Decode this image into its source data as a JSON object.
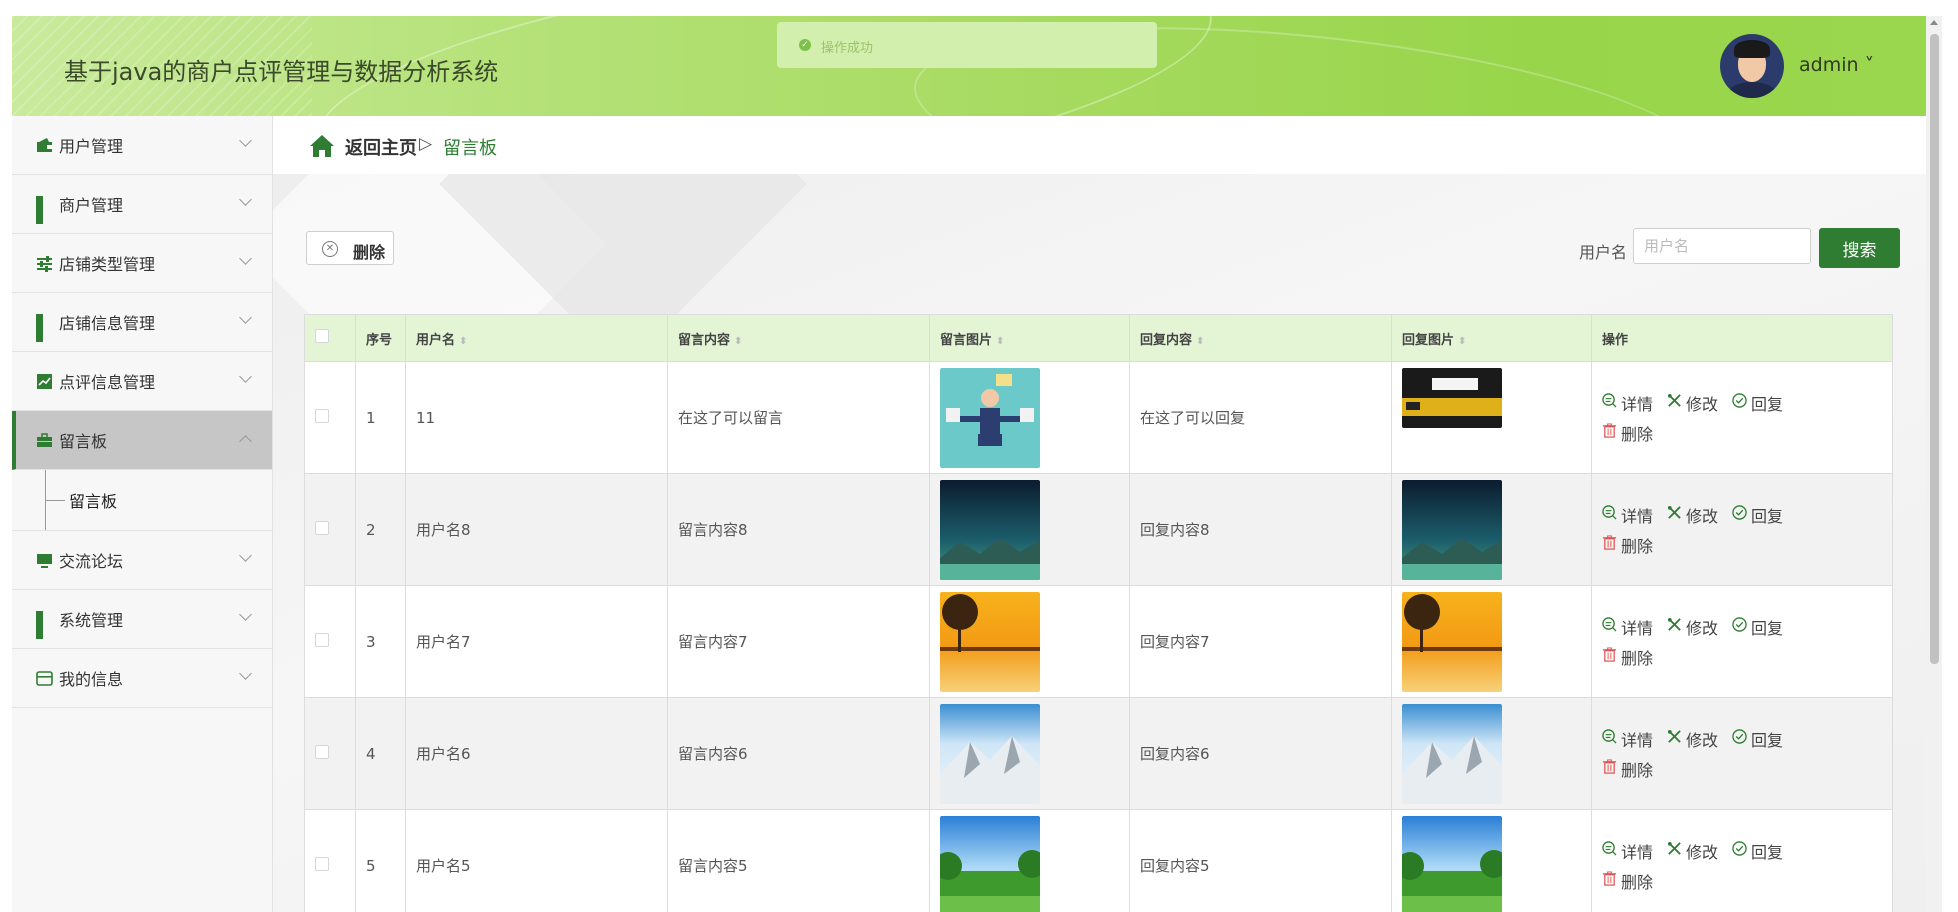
{
  "header": {
    "title": "基于java的商户点评管理与数据分析系统",
    "toast": "操作成功",
    "user": "admin ˅"
  },
  "sidebar": {
    "items": [
      {
        "label": "用户管理",
        "icon": "wallet-icon"
      },
      {
        "label": "商户管理",
        "icon": "grid-icon"
      },
      {
        "label": "店铺类型管理",
        "icon": "sliders-icon"
      },
      {
        "label": "店铺信息管理",
        "icon": "grid-icon"
      },
      {
        "label": "点评信息管理",
        "icon": "chart-icon"
      },
      {
        "label": "留言板",
        "icon": "briefcase-icon",
        "active": true
      },
      {
        "label": "交流论坛",
        "icon": "monitor-icon"
      },
      {
        "label": "系统管理",
        "icon": "grid-icon"
      },
      {
        "label": "我的信息",
        "icon": "card-icon"
      }
    ],
    "sub_item": "留言板"
  },
  "breadcrumb": {
    "home": "返回主页",
    "separator": "▷",
    "current": "留言板"
  },
  "toolbar": {
    "delete_label": "删除",
    "search_label": "用户名",
    "search_placeholder": "用户名",
    "search_button": "搜索"
  },
  "table": {
    "columns": [
      "",
      "序号",
      "用户名",
      "留言内容",
      "留言图片",
      "回复内容",
      "回复图片",
      "操作"
    ],
    "rows": [
      {
        "no": "1",
        "user": "11",
        "content": "在这了可以留言",
        "reply": "在这了可以回复",
        "img": "people",
        "rimg": "train"
      },
      {
        "no": "2",
        "user": "用户名8",
        "content": "留言内容8",
        "reply": "回复内容8",
        "img": "night",
        "rimg": "night"
      },
      {
        "no": "3",
        "user": "用户名7",
        "content": "留言内容7",
        "reply": "回复内容7",
        "img": "sunset",
        "rimg": "sunset"
      },
      {
        "no": "4",
        "user": "用户名6",
        "content": "留言内容6",
        "reply": "回复内容6",
        "img": "snow",
        "rimg": "snow"
      },
      {
        "no": "5",
        "user": "用户名5",
        "content": "留言内容5",
        "reply": "回复内容5",
        "img": "meadow",
        "rimg": "meadow"
      }
    ],
    "actions": {
      "detail": "详情",
      "edit": "修改",
      "reply": "回复",
      "delete": "删除"
    }
  },
  "colors": {
    "accent": "#2e7d32",
    "header_green": "#a6da5f",
    "table_head": "#e4f5d6"
  }
}
